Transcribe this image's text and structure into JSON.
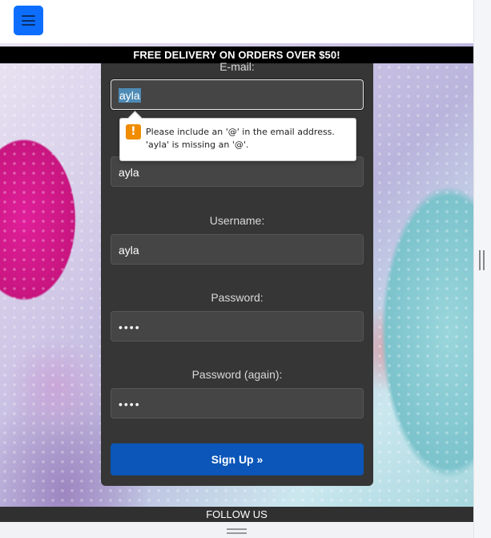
{
  "banner": {
    "text": "FREE DELIVERY ON ORDERS OVER $50!"
  },
  "menu": {
    "icon": "hamburger-menu-icon"
  },
  "form": {
    "email": {
      "label": "E-mail:",
      "value": "ayla"
    },
    "name": {
      "value": "ayla"
    },
    "username": {
      "label": "Username:",
      "value": "ayla"
    },
    "password": {
      "label": "Password:",
      "value": "••••"
    },
    "password_again": {
      "label": "Password (again):",
      "value": "••••"
    },
    "submit_label": "Sign Up »"
  },
  "validation": {
    "icon": "warning-icon",
    "icon_glyph": "!",
    "message": "Please include an '@' in the email address. 'ayla' is missing an '@'."
  },
  "footer": {
    "text": "FOLLOW US"
  },
  "colors": {
    "menu_button": "#0d6efd",
    "panel": "#363636",
    "submit": "#0b56b8",
    "warning": "#f08c00"
  }
}
